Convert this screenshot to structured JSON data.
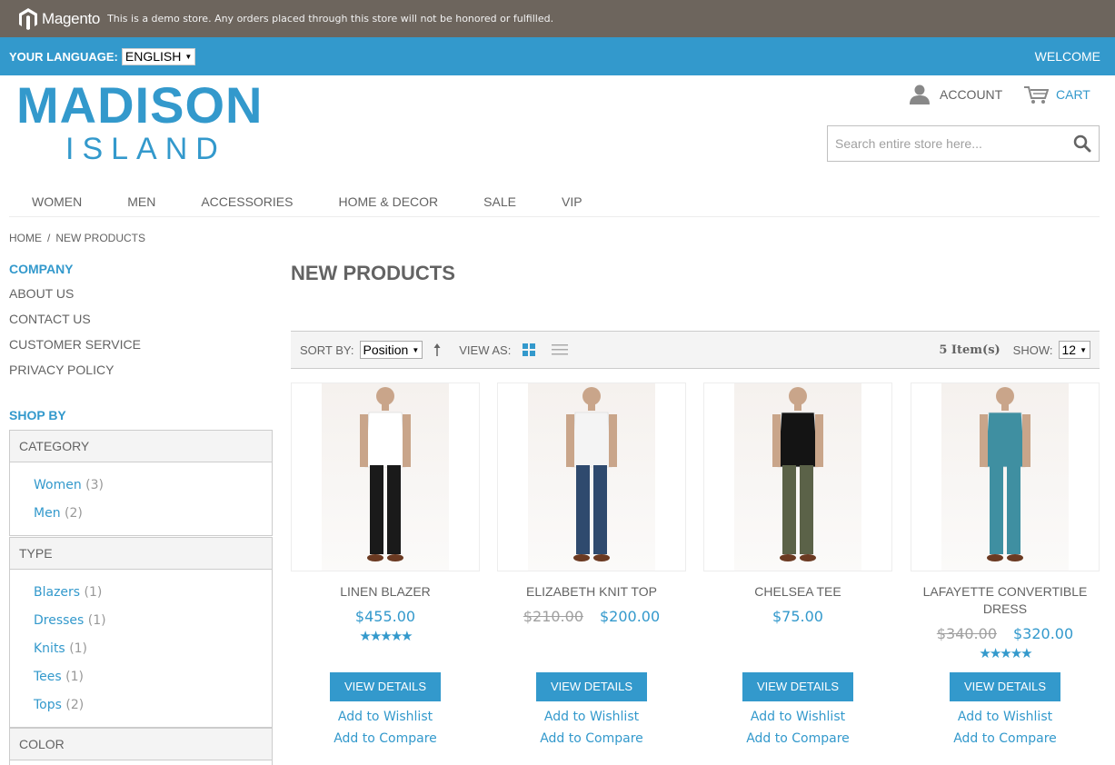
{
  "demo_notice": {
    "brand": "Magento",
    "text": "This is a demo store. Any orders placed through this store will not be honored or fulfilled."
  },
  "language_bar": {
    "label": "YOUR LANGUAGE:",
    "selected": "ENGLISH",
    "welcome": "WELCOME"
  },
  "header": {
    "logo_line1": "MADISON",
    "logo_line2": "ISLAND",
    "account": "ACCOUNT",
    "cart": "CART",
    "search_placeholder": "Search entire store here..."
  },
  "nav": [
    "WOMEN",
    "MEN",
    "ACCESSORIES",
    "HOME & DECOR",
    "SALE",
    "VIP"
  ],
  "breadcrumb": {
    "home": "HOME",
    "separator": "/",
    "current": "NEW PRODUCTS"
  },
  "sidebar": {
    "company_heading": "COMPANY",
    "company_links": [
      "ABOUT US",
      "CONTACT US",
      "CUSTOMER SERVICE",
      "PRIVACY POLICY"
    ],
    "shop_by_heading": "SHOP BY",
    "filters": [
      {
        "title": "CATEGORY",
        "options": [
          {
            "label": "Women",
            "count": "(3)"
          },
          {
            "label": "Men",
            "count": "(2)"
          }
        ]
      },
      {
        "title": "TYPE",
        "options": [
          {
            "label": "Blazers",
            "count": "(1)"
          },
          {
            "label": "Dresses",
            "count": "(1)"
          },
          {
            "label": "Knits",
            "count": "(1)"
          },
          {
            "label": "Tees",
            "count": "(1)"
          },
          {
            "label": "Tops",
            "count": "(2)"
          }
        ]
      },
      {
        "title": "COLOR",
        "options": []
      }
    ]
  },
  "main": {
    "title": "NEW PRODUCTS",
    "toolbar": {
      "sort_label": "SORT BY:",
      "sort_value": "Position",
      "view_label": "VIEW AS:",
      "items": "5 Item(s)",
      "show_label": "SHOW:",
      "show_value": "12"
    }
  },
  "products": [
    {
      "name": "LINEN BLAZER",
      "old_price": "",
      "price": "$455.00",
      "stars": "★★★★★",
      "button": "VIEW DETAILS",
      "wishlist": "Add to Wishlist",
      "compare": "Add to Compare",
      "colors": {
        "top": "#ffffff",
        "bottom": "#1a1a1a"
      }
    },
    {
      "name": "ELIZABETH KNIT TOP",
      "old_price": "$210.00",
      "price": "$200.00",
      "stars": "",
      "button": "VIEW DETAILS",
      "wishlist": "Add to Wishlist",
      "compare": "Add to Compare",
      "colors": {
        "top": "#f4f4f4",
        "bottom": "#2f4a6e"
      }
    },
    {
      "name": "CHELSEA TEE",
      "old_price": "",
      "price": "$75.00",
      "stars": "",
      "button": "VIEW DETAILS",
      "wishlist": "Add to Wishlist",
      "compare": "Add to Compare",
      "colors": {
        "top": "#141414",
        "bottom": "#5b6248"
      }
    },
    {
      "name": "LAFAYETTE CONVERTIBLE DRESS",
      "old_price": "$340.00",
      "price": "$320.00",
      "stars": "★★★★★",
      "button": "VIEW DETAILS",
      "wishlist": "Add to Wishlist",
      "compare": "Add to Compare",
      "colors": {
        "top": "#3f8fa1",
        "bottom": "#3f8fa1"
      }
    }
  ],
  "colors": {
    "accent": "#3399cc",
    "demo_bar": "#6d655d",
    "text": "#636363"
  }
}
